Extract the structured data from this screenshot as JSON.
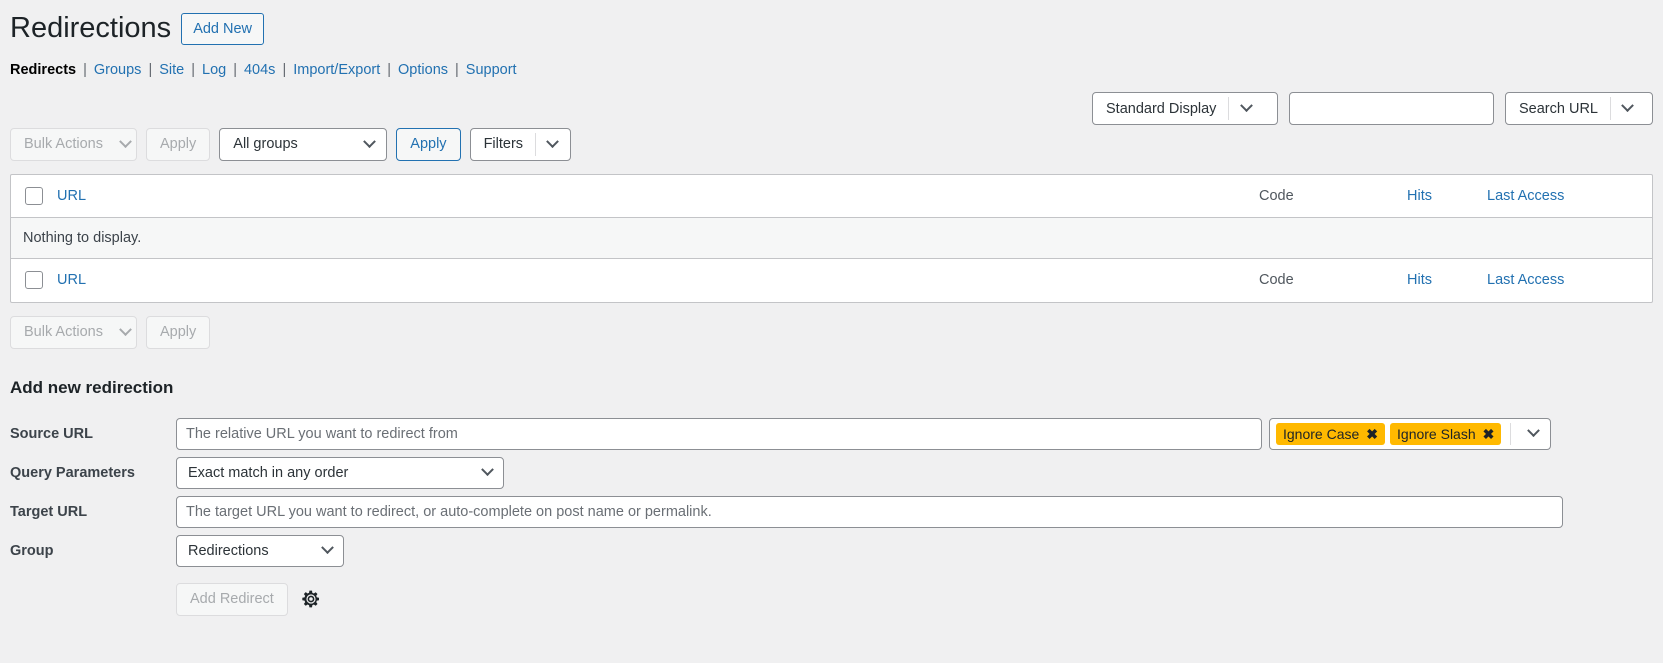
{
  "header": {
    "title": "Redirections",
    "add_new_label": "Add New"
  },
  "subnav": {
    "items": [
      {
        "label": "Redirects",
        "current": true
      },
      {
        "label": "Groups",
        "current": false
      },
      {
        "label": "Site",
        "current": false
      },
      {
        "label": "Log",
        "current": false
      },
      {
        "label": "404s",
        "current": false
      },
      {
        "label": "Import/Export",
        "current": false
      },
      {
        "label": "Options",
        "current": false
      },
      {
        "label": "Support",
        "current": false
      }
    ],
    "separator": "|"
  },
  "top_controls": {
    "display_mode": "Standard Display",
    "search_value": "",
    "search_placeholder": "",
    "search_scope": "Search URL"
  },
  "tablenav": {
    "bulk_actions_label": "Bulk Actions",
    "apply_label": "Apply",
    "group_filter_label": "All groups",
    "apply_group_label": "Apply",
    "filters_label": "Filters"
  },
  "table": {
    "columns": {
      "url": "URL",
      "code": "Code",
      "hits": "Hits",
      "last_access": "Last Access"
    },
    "empty_message": "Nothing to display.",
    "rows": []
  },
  "form": {
    "title": "Add new redirection",
    "source_url": {
      "label": "Source URL",
      "value": "",
      "placeholder": "The relative URL you want to redirect from"
    },
    "flags": [
      {
        "label": "Ignore Case",
        "remove": "✖"
      },
      {
        "label": "Ignore Slash",
        "remove": "✖"
      }
    ],
    "query_parameters": {
      "label": "Query Parameters",
      "value": "Exact match in any order"
    },
    "target_url": {
      "label": "Target URL",
      "value": "",
      "placeholder": "The target URL you want to redirect, or auto-complete on post name or permalink."
    },
    "group": {
      "label": "Group",
      "value": "Redirections"
    },
    "submit_label": "Add Redirect",
    "advanced_icon": "gear-icon"
  },
  "colors": {
    "link": "#2271b1",
    "tag_bg": "#ffb900",
    "page_bg": "#f0f0f1",
    "border": "#8c8f94"
  }
}
